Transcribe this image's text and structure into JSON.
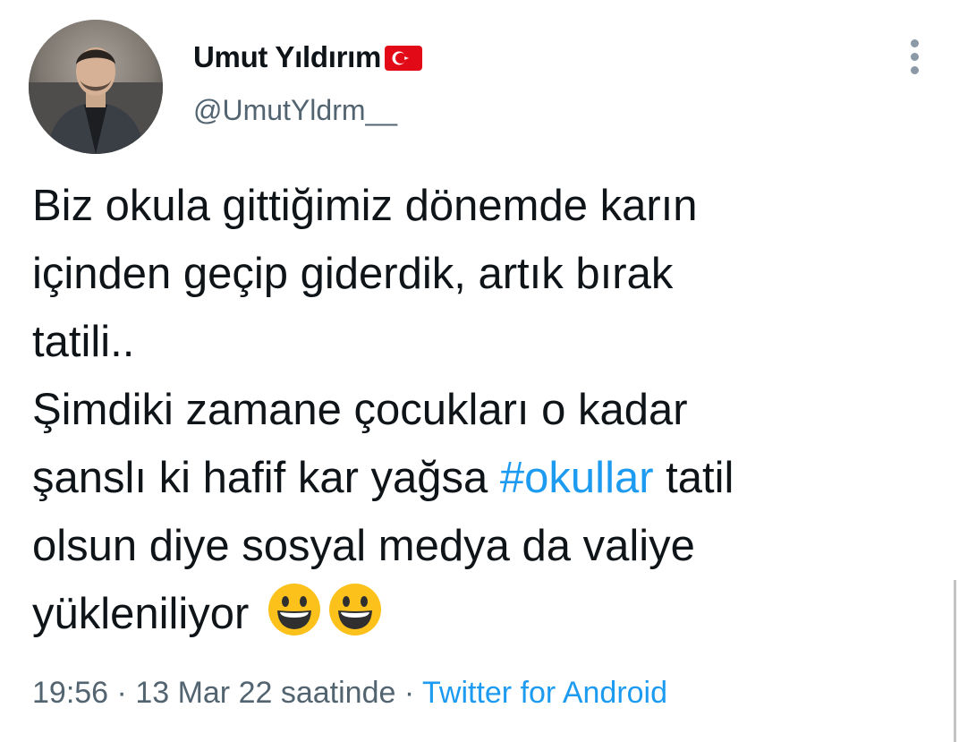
{
  "author": {
    "display_name": "Umut Yıldırım",
    "handle": "@UmutYldrm__",
    "flag_icon": "turkey-flag-icon",
    "avatar_icon": "profile-photo"
  },
  "menu": {
    "icon": "more-options-icon"
  },
  "tweet": {
    "lines": [
      "Biz okula gittiğimiz dönemde karın",
      "içinden geçip giderdik, artık bırak",
      "tatili..",
      "Şimdiki zamane çocukları o kadar",
      "şanslı ki hafif kar yağsa",
      "olsun diye sosyal medya da valiye",
      "yükleniliyor"
    ],
    "hashtag": "#okullar",
    "after_hashtag": "tatil",
    "emoji_icon": "grinning-face-emoji"
  },
  "meta": {
    "time": "19:56",
    "separator": " · ",
    "date": "13 Mar 22 saatinde",
    "source": "Twitter for Android"
  },
  "colors": {
    "link": "#1d9bf0",
    "secondary": "#536471",
    "text": "#0f1419"
  }
}
